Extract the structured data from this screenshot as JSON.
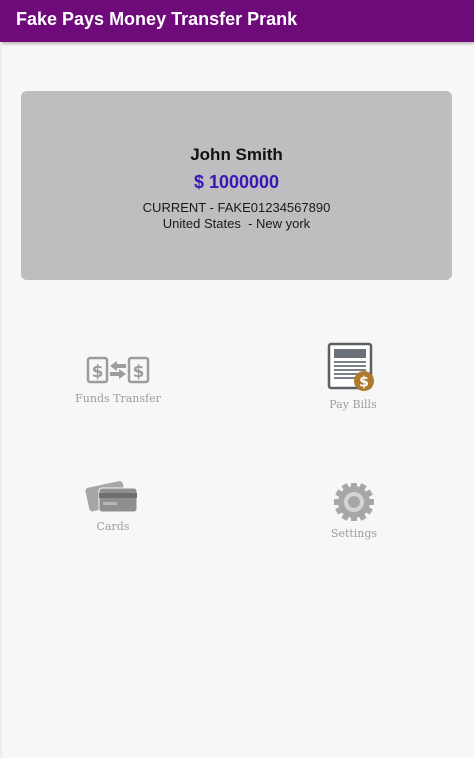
{
  "app": {
    "title": "Fake Pays Money Transfer Prank"
  },
  "account": {
    "name": "John Smith",
    "balance": "$ 1000000",
    "account_line": "CURRENT - FAKE01234567890",
    "location": "United States  - New york"
  },
  "menu": {
    "funds_transfer": {
      "label": "Funds Transfer",
      "icon": "funds-transfer-icon"
    },
    "pay_bills": {
      "label": "Pay Bills",
      "icon": "bill-icon"
    },
    "cards": {
      "label": "Cards",
      "icon": "credit-card-icon"
    },
    "settings": {
      "label": "Settings",
      "icon": "gear-icon"
    }
  },
  "colors": {
    "appbar": "#6e0a7a",
    "balance": "#3a16b5",
    "card_bg": "#bebdc0",
    "coin": "#b07a2e"
  }
}
